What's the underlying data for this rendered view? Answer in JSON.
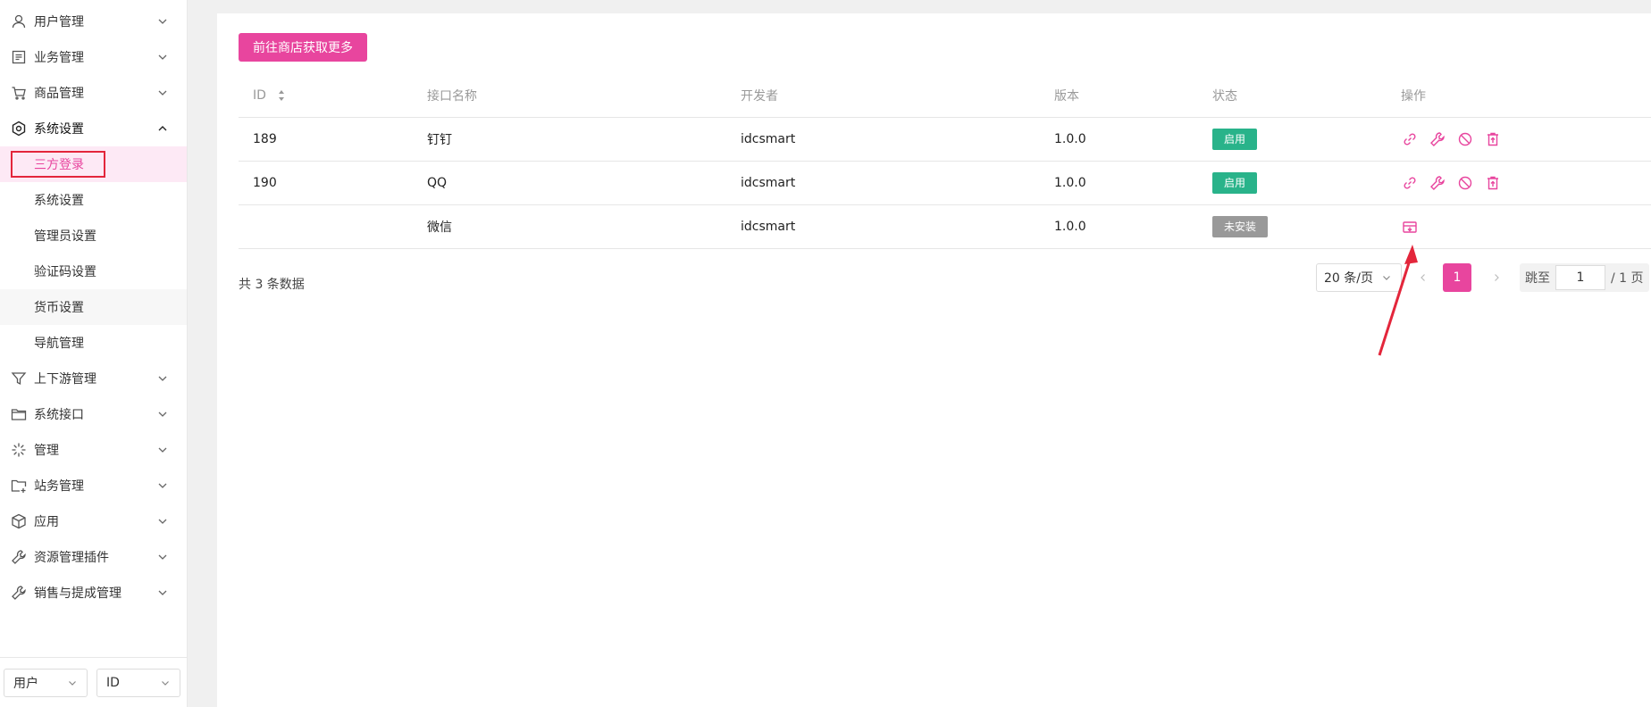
{
  "sidebar": {
    "items": [
      {
        "label": "用户管理",
        "icon": "user-icon"
      },
      {
        "label": "业务管理",
        "icon": "document-list-icon"
      },
      {
        "label": "商品管理",
        "icon": "cart-icon"
      },
      {
        "label": "系统设置",
        "icon": "settings-hex-icon",
        "expanded": true
      }
    ],
    "sub_items": [
      "三方登录",
      "系统设置",
      "管理员设置",
      "验证码设置",
      "货币设置",
      "导航管理"
    ],
    "items_after": [
      {
        "label": "上下游管理",
        "icon": "funnel-icon"
      },
      {
        "label": "系统接口",
        "icon": "folder-icon"
      },
      {
        "label": "管理",
        "icon": "spark-icon"
      },
      {
        "label": "站务管理",
        "icon": "folder-plus-icon"
      },
      {
        "label": "应用",
        "icon": "cube-icon"
      },
      {
        "label": "资源管理插件",
        "icon": "wrench-icon"
      },
      {
        "label": "销售与提成管理",
        "icon": "wrench-icon"
      }
    ],
    "bottom": {
      "type_select": "用户",
      "field_select": "ID"
    }
  },
  "toolbar": {
    "store_button": "前往商店获取更多"
  },
  "table": {
    "headers": {
      "id": "ID",
      "name": "接口名称",
      "developer": "开发者",
      "version": "版本",
      "status": "状态",
      "ops": "操作"
    },
    "rows": [
      {
        "id": "189",
        "name": "钉钉",
        "developer": "idcsmart",
        "version": "1.0.0",
        "status": "启用",
        "installed": true
      },
      {
        "id": "190",
        "name": "QQ",
        "developer": "idcsmart",
        "version": "1.0.0",
        "status": "启用",
        "installed": true
      },
      {
        "id": "",
        "name": "微信",
        "developer": "idcsmart",
        "version": "1.0.0",
        "status": "未安装",
        "installed": false
      }
    ]
  },
  "footer": {
    "total_text": "共 3 条数据"
  },
  "pagination": {
    "page_size": "20 条/页",
    "current_page": "1",
    "jump_label": "跳至",
    "jump_value": "1",
    "total_pages_text": "/ 1 页"
  },
  "colors": {
    "accent": "#e8459e",
    "success": "#29b38a",
    "neutral": "#999999",
    "annotation": "#e3263b"
  }
}
